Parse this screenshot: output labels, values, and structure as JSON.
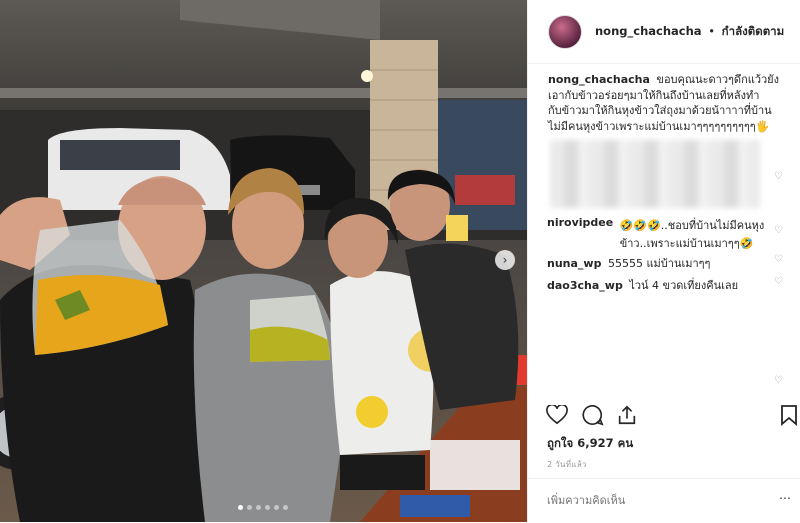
{
  "photo": {
    "description_icon": "photo",
    "carousel_dots": 6,
    "active_dot": 1,
    "next_icon": "chevron-right-icon"
  },
  "header": {
    "username": "nong_chachacha",
    "separator": "•",
    "follow_label": "กำลังติดตาม"
  },
  "caption": {
    "username": "nong_chachacha",
    "text": "ขอบคุณนะดาวๆดึกแว้วยังเอากับข้าวอร่อยๆมาให้กินถึงบ้านเลยที่หลังทำกับข้าวมาให้กินหุงข้าวใส่ถุงมาด้วยน้าาาาที่บ้านไม่มีคนหุงข้าวเพราะแม่บ้านเมาๆๆๆๆๆๆๆๆๆๆ🖐"
  },
  "comments": [
    {
      "username": "nirovipdee",
      "text": "🤣🤣🤣..ชอบที่บ้านไม่มีคนหุงข้าว..เพราะแม่บ้านเมาๆๆ🤣"
    },
    {
      "username": "nuna_wp",
      "text": "55555 แม่บ้านเมาๆๆ"
    },
    {
      "username": "dao3cha_wp",
      "text": "ไวน์ 4 ขวดเที่ยงคืนเลย"
    }
  ],
  "likes": {
    "label": "ถูกใจ 6,927 คน"
  },
  "timestamp": "2 วันที่แล้ว",
  "comment_box": {
    "placeholder": "เพิ่มความคิดเห็น",
    "more_icon": "ellipsis-icon"
  },
  "icons": {
    "like": "heart-icon",
    "comment": "comment-icon",
    "share": "share-icon",
    "save": "bookmark-icon"
  }
}
